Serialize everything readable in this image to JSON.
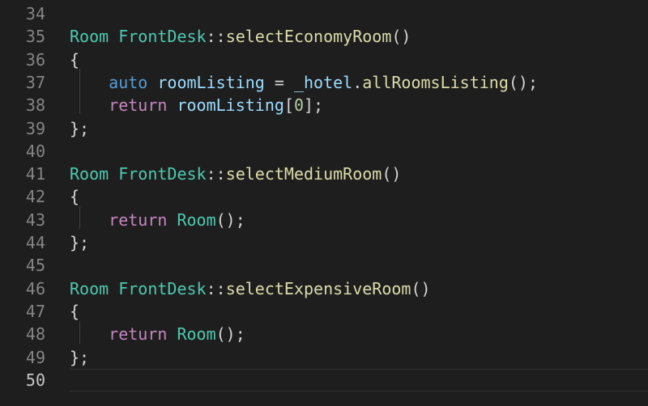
{
  "editor": {
    "lines": [
      {
        "num": "34",
        "tokens": []
      },
      {
        "num": "35",
        "tokens": [
          {
            "t": "Room",
            "c": "type"
          },
          {
            "t": " ",
            "c": "punc"
          },
          {
            "t": "FrontDesk",
            "c": "type"
          },
          {
            "t": "::",
            "c": "punc"
          },
          {
            "t": "selectEconomyRoom",
            "c": "func"
          },
          {
            "t": "()",
            "c": "punc"
          }
        ]
      },
      {
        "num": "36",
        "tokens": [
          {
            "t": "{",
            "c": "punc"
          }
        ]
      },
      {
        "num": "37",
        "tokens": [
          {
            "t": "    ",
            "c": "punc"
          },
          {
            "t": "auto",
            "c": "kw"
          },
          {
            "t": " ",
            "c": "punc"
          },
          {
            "t": "roomListing",
            "c": "var"
          },
          {
            "t": " = ",
            "c": "punc"
          },
          {
            "t": "_hotel",
            "c": "var"
          },
          {
            "t": ".",
            "c": "punc"
          },
          {
            "t": "allRoomsListing",
            "c": "func"
          },
          {
            "t": "();",
            "c": "punc"
          }
        ]
      },
      {
        "num": "38",
        "tokens": [
          {
            "t": "    ",
            "c": "punc"
          },
          {
            "t": "return",
            "c": "ctrl"
          },
          {
            "t": " ",
            "c": "punc"
          },
          {
            "t": "roomListing",
            "c": "var"
          },
          {
            "t": "[",
            "c": "punc"
          },
          {
            "t": "0",
            "c": "num"
          },
          {
            "t": "];",
            "c": "punc"
          }
        ]
      },
      {
        "num": "39",
        "tokens": [
          {
            "t": "};",
            "c": "punc"
          }
        ]
      },
      {
        "num": "40",
        "tokens": []
      },
      {
        "num": "41",
        "tokens": [
          {
            "t": "Room",
            "c": "type"
          },
          {
            "t": " ",
            "c": "punc"
          },
          {
            "t": "FrontDesk",
            "c": "type"
          },
          {
            "t": "::",
            "c": "punc"
          },
          {
            "t": "selectMediumRoom",
            "c": "func"
          },
          {
            "t": "()",
            "c": "punc"
          }
        ]
      },
      {
        "num": "42",
        "tokens": [
          {
            "t": "{",
            "c": "punc"
          }
        ]
      },
      {
        "num": "43",
        "tokens": [
          {
            "t": "    ",
            "c": "punc"
          },
          {
            "t": "return",
            "c": "ctrl"
          },
          {
            "t": " ",
            "c": "punc"
          },
          {
            "t": "Room",
            "c": "type"
          },
          {
            "t": "();",
            "c": "punc"
          }
        ]
      },
      {
        "num": "44",
        "tokens": [
          {
            "t": "};",
            "c": "punc"
          }
        ]
      },
      {
        "num": "45",
        "tokens": []
      },
      {
        "num": "46",
        "tokens": [
          {
            "t": "Room",
            "c": "type"
          },
          {
            "t": " ",
            "c": "punc"
          },
          {
            "t": "FrontDesk",
            "c": "type"
          },
          {
            "t": "::",
            "c": "punc"
          },
          {
            "t": "selectExpensiveRoom",
            "c": "func"
          },
          {
            "t": "()",
            "c": "punc"
          }
        ]
      },
      {
        "num": "47",
        "tokens": [
          {
            "t": "{",
            "c": "punc"
          }
        ]
      },
      {
        "num": "48",
        "tokens": [
          {
            "t": "    ",
            "c": "punc"
          },
          {
            "t": "return",
            "c": "ctrl"
          },
          {
            "t": " ",
            "c": "punc"
          },
          {
            "t": "Room",
            "c": "type"
          },
          {
            "t": "();",
            "c": "punc"
          }
        ]
      },
      {
        "num": "49",
        "tokens": [
          {
            "t": "};",
            "c": "punc"
          }
        ]
      },
      {
        "num": "50",
        "tokens": [],
        "current": true
      }
    ]
  },
  "colors": {
    "background": "#1e1e1e",
    "type": "#4ec9b0",
    "function": "#dcdcaa",
    "keyword": "#569cd6",
    "control": "#c586c0",
    "variable": "#9cdcfe",
    "number": "#b5cea8",
    "punctuation": "#d4d4d4",
    "line_number": "#858585",
    "current_line_number": "#c6c6c6"
  }
}
